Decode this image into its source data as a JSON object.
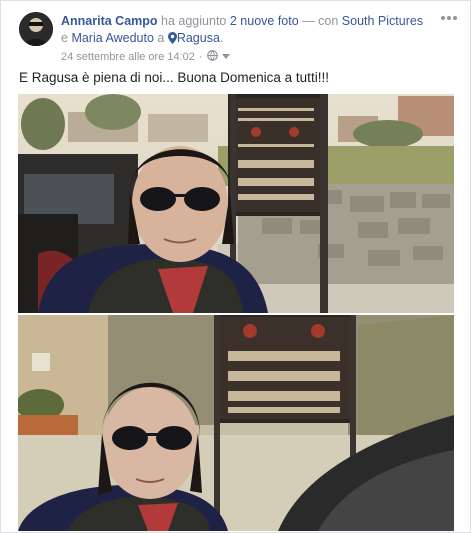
{
  "post": {
    "author": "Annarita Campo",
    "action_text": "ha aggiunto",
    "photos_link": "2 nuove foto",
    "with_text": "— con",
    "tagged_1": "South Pictures",
    "and_text": "e",
    "tagged_2": "Maria Aweduto",
    "at_text": "a",
    "location": "Ragusa",
    "period": ".",
    "timestamp": "24 settembre alle ore 14:02",
    "separator": "·",
    "caption": "E Ragusa è piena di noi... Buona Domenica a tutti!!!",
    "icons": {
      "location": "map-pin-icon",
      "privacy": "globe-icon",
      "audience_dropdown": "chevron-down-icon",
      "menu": "more-horizontal-icon"
    },
    "colors": {
      "link": "#365899",
      "meta": "#90949c",
      "text": "#1d2129"
    }
  }
}
